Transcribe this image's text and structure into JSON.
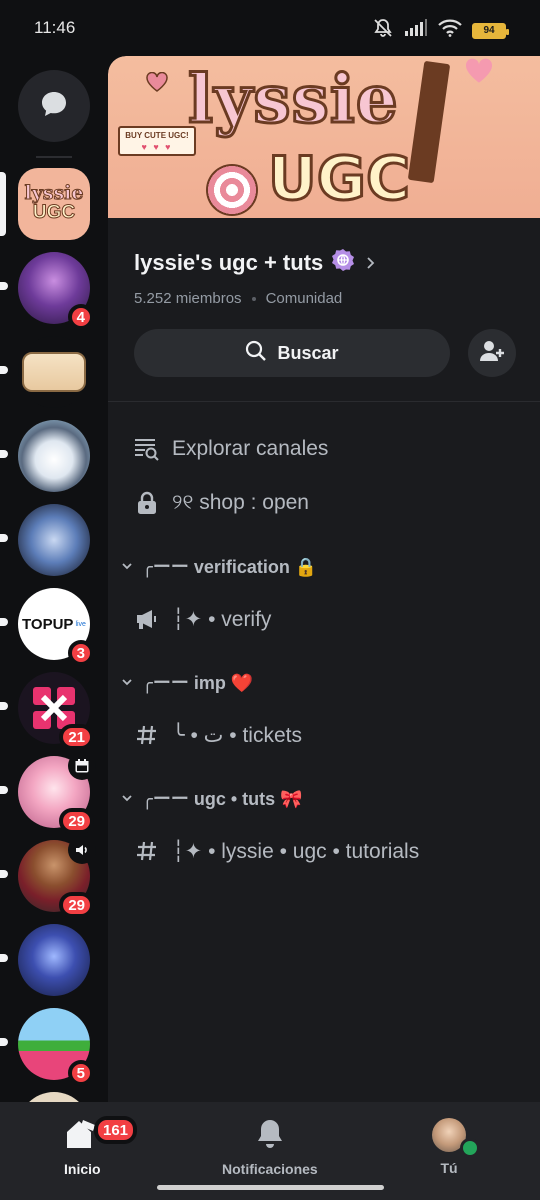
{
  "status_bar": {
    "time": "11:46",
    "battery": "94"
  },
  "rail": {
    "servers": [
      {
        "id": "lyssie",
        "selected": true,
        "badge": ""
      },
      {
        "id": "anime-girl-purple",
        "badge": "4"
      },
      {
        "id": "logo-server",
        "badge": ""
      },
      {
        "id": "husky",
        "badge": ""
      },
      {
        "id": "blue-creatures",
        "badge": ""
      },
      {
        "id": "topup",
        "badge": "3",
        "label": "TOPUP",
        "sub": "live"
      },
      {
        "id": "pink-dice",
        "badge": "21"
      },
      {
        "id": "pink-hair",
        "badge": "29",
        "corner": "calendar"
      },
      {
        "id": "guy",
        "badge": "29",
        "corner": "speaker"
      },
      {
        "id": "blue-knight",
        "badge": ""
      },
      {
        "id": "roblox-pink",
        "badge": "5"
      }
    ]
  },
  "banner": {
    "line1": "lyssie",
    "line2": "UGC",
    "tag": "BUY CUTE UGC!",
    "tag_hearts": "♥ ♥ ♥"
  },
  "server": {
    "name": "lyssie's ugc + tuts",
    "members": "5.252 miembros",
    "type": "Comunidad",
    "search_label": "Buscar"
  },
  "channels": {
    "explore": "Explorar canales",
    "shop": "୨୧ shop : open",
    "categories": [
      {
        "name": "╭ーー verification 🔒",
        "channels": [
          {
            "icon": "announcement",
            "name": "┆✦ • verify"
          }
        ]
      },
      {
        "name": "╭ーー imp ❤️",
        "channels": [
          {
            "icon": "hash",
            "name": "╰ • ت • tickets"
          }
        ]
      },
      {
        "name": "╭ーー ugc • tuts 🎀",
        "channels": [
          {
            "icon": "hash",
            "name": "┆✦ • lyssie • ugc • tutorials"
          }
        ]
      }
    ]
  },
  "nav": {
    "home": "Inicio",
    "home_badge": "161",
    "notifications": "Notificaciones",
    "you": "Tú"
  },
  "colors": {
    "accent_red": "#f23f43",
    "panel": "#1a1b1e",
    "rail": "#0f1012",
    "online": "#23a55a"
  }
}
